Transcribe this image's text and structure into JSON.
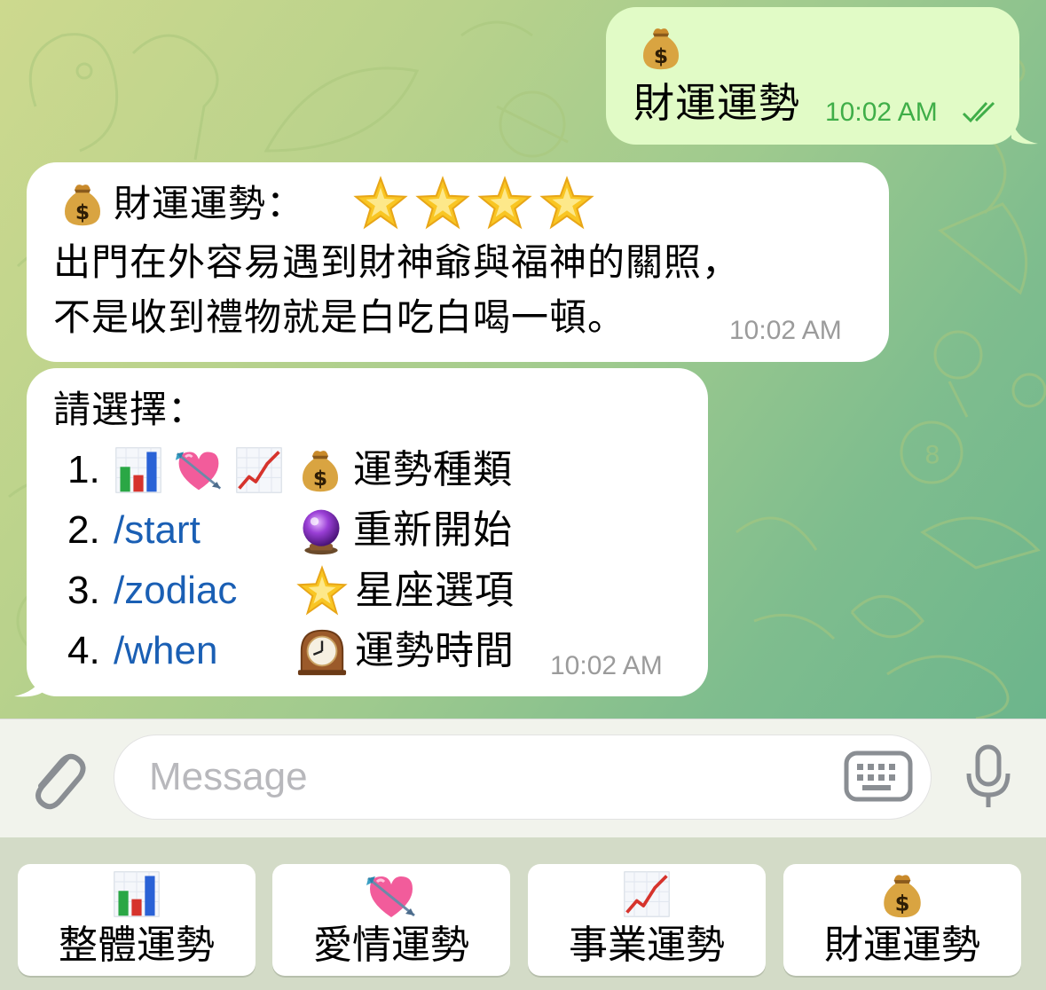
{
  "outgoing": {
    "emoji": "money-bag",
    "text": "財運運勢",
    "time": "10:02 AM"
  },
  "incoming_fortune": {
    "title": "財運運勢：",
    "stars": 4,
    "line1": "出門在外容易遇到財神爺與福神的關照，",
    "line2": "不是收到禮物就是白吃白喝一頓。",
    "time": "10:02 AM"
  },
  "incoming_menu": {
    "heading": "請選擇：",
    "items": [
      {
        "num": "1.",
        "command": "",
        "icons": [
          "bar-chart",
          "heart-arrow",
          "trend-up",
          "money-bag"
        ],
        "label": "運勢種類"
      },
      {
        "num": "2.",
        "command": "/start",
        "icons": [
          "crystal-ball"
        ],
        "label": "重新開始"
      },
      {
        "num": "3.",
        "command": "/zodiac",
        "icons": [
          "star"
        ],
        "label": "星座選項"
      },
      {
        "num": "4.",
        "command": "/when",
        "icons": [
          "mantel-clock"
        ],
        "label": "運勢時間"
      }
    ],
    "time": "10:02 AM"
  },
  "composer": {
    "placeholder": "Message"
  },
  "keyboard": {
    "buttons": [
      {
        "icon": "bar-chart",
        "label": "整體運勢"
      },
      {
        "icon": "heart-arrow",
        "label": "愛情運勢"
      },
      {
        "icon": "trend-up",
        "label": "事業運勢"
      },
      {
        "icon": "money-bag",
        "label": "財運運勢"
      }
    ]
  },
  "colors": {
    "outgoing_bubble": "#e1fbc6",
    "incoming_bubble": "#ffffff",
    "link": "#1a5fb4",
    "out_time": "#3fae48"
  }
}
